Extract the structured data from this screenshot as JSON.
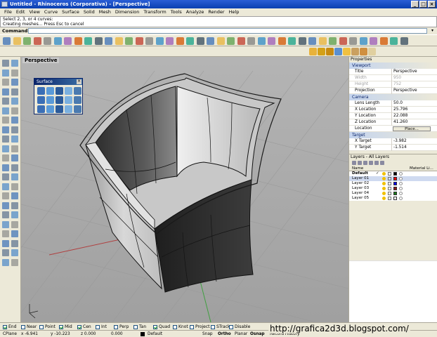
{
  "window": {
    "title": "Untitled - Rhinoceros (Corporativa) - [Perspective]",
    "buttons": [
      "_",
      "□",
      "×"
    ]
  },
  "menu": [
    "File",
    "Edit",
    "View",
    "Curve",
    "Surface",
    "Solid",
    "Mesh",
    "Dimension",
    "Transform",
    "Tools",
    "Analyze",
    "Render",
    "Help"
  ],
  "command_history": [
    "Select 2, 3, or 4 curves:",
    "Creating meshes... Press Esc to cancel"
  ],
  "command_prompt": "Command:",
  "viewport": {
    "label": "Perspective"
  },
  "surface_palette": {
    "title": "Surface",
    "close": "×"
  },
  "properties": {
    "title": "Properties",
    "viewport_section": "Viewport",
    "viewport_rows": [
      {
        "k": "Title",
        "v": "Perspective",
        "disabled": false
      },
      {
        "k": "Width",
        "v": "950",
        "disabled": true
      },
      {
        "k": "Height",
        "v": "752",
        "disabled": true
      },
      {
        "k": "Projection",
        "v": "Perspective",
        "disabled": false
      }
    ],
    "camera_section": "Camera",
    "camera_rows": [
      {
        "k": "Lens Length",
        "v": "50.0"
      },
      {
        "k": "X Location",
        "v": "25.796"
      },
      {
        "k": "Y Location",
        "v": "22.088"
      },
      {
        "k": "Z Location",
        "v": "41.260"
      }
    ],
    "location_label": "Location",
    "place_button": "Place...",
    "target_section": "Target",
    "target_rows": [
      {
        "k": "X Target",
        "v": "-3.982"
      },
      {
        "k": "Y Target",
        "v": "-1.514"
      }
    ]
  },
  "layers": {
    "title": "Layers - All Layers",
    "columns": [
      "Name",
      "Material Li..."
    ],
    "rows": [
      {
        "name": "Default",
        "bold": true,
        "check": "✓",
        "color": "#000000"
      },
      {
        "name": "Layer 01",
        "bold": false,
        "check": "",
        "color": "#ff0000",
        "selected": true
      },
      {
        "name": "Layer 02",
        "bold": false,
        "check": "",
        "color": "#0000ff"
      },
      {
        "name": "Layer 03",
        "bold": false,
        "check": "",
        "color": "#8b1a1a"
      },
      {
        "name": "Layer 04",
        "bold": false,
        "check": "",
        "color": "#1a7a1a"
      },
      {
        "name": "Layer 05",
        "bold": false,
        "check": "",
        "color": "#ffffff"
      }
    ]
  },
  "osnaps": [
    {
      "label": "End",
      "on": true
    },
    {
      "label": "Near",
      "on": false
    },
    {
      "label": "Point",
      "on": false
    },
    {
      "label": "Mid",
      "on": true
    },
    {
      "label": "Cen",
      "on": true
    },
    {
      "label": "Int",
      "on": false
    },
    {
      "label": "Perp",
      "on": false
    },
    {
      "label": "Tan",
      "on": false
    },
    {
      "label": "Quad",
      "on": true
    },
    {
      "label": "Knot",
      "on": false
    },
    {
      "label": "Project",
      "on": false
    },
    {
      "label": "STrack",
      "on": false
    },
    {
      "label": "Disable",
      "on": false
    }
  ],
  "status": {
    "cplane": "CPlane",
    "x": "x -6.941",
    "y": "y -10.223",
    "z": "z 0.000",
    "d": "0.000",
    "layer": "Default",
    "toggles": [
      "Snap",
      "Ortho",
      "Planar",
      "Osnap",
      "Record History"
    ]
  },
  "watermark": "http://grafica2d3d.blogspot.com/"
}
